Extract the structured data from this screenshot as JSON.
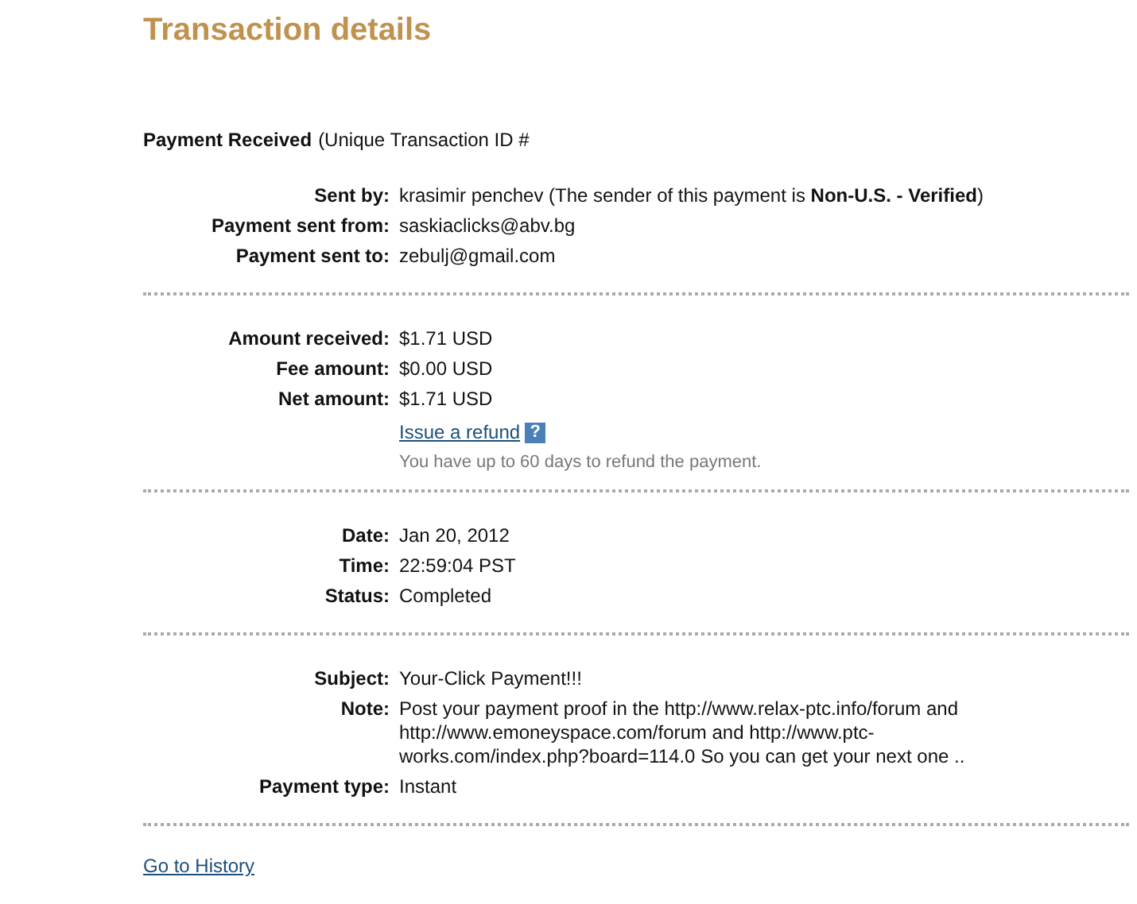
{
  "title": "Transaction details",
  "heading": {
    "label": "Payment Received",
    "text": "(Unique Transaction ID #"
  },
  "sections": [
    {
      "rows": [
        {
          "label": "Sent by:",
          "value": "krasimir penchev (The sender of this payment is **Non-U.S. - Verified**)"
        },
        {
          "label": "Payment sent from:",
          "value": "saskiaclicks@abv.bg"
        },
        {
          "label": "Payment sent to:",
          "value": "zebulj@gmail.com"
        }
      ]
    },
    {
      "rows": [
        {
          "label": "Amount received:",
          "value": "$1.71 USD"
        },
        {
          "label": "Fee amount:",
          "value": "$0.00 USD"
        },
        {
          "label": "Net amount:",
          "value": "$1.71 USD"
        }
      ],
      "refund": {
        "link": "Issue a refund",
        "help": "?",
        "hint": "You have up to 60 days to refund the payment."
      }
    },
    {
      "rows": [
        {
          "label": "Date:",
          "value": "Jan 20, 2012"
        },
        {
          "label": "Time:",
          "value": "22:59:04 PST"
        },
        {
          "label": "Status:",
          "value": "Completed"
        }
      ]
    },
    {
      "rows": [
        {
          "label": "Subject:",
          "value": "Your-Click Payment!!!"
        },
        {
          "label": "Note:",
          "value": "Post your payment proof in the http://www.relax-ptc.info/forum and http://www.emoneyspace.com/forum and http://www.ptc-works.com/index.php?board=114.0 So you can get your next one .."
        },
        {
          "label": "Payment type:",
          "value": "Instant"
        }
      ]
    }
  ],
  "footer_link": "Go to History"
}
